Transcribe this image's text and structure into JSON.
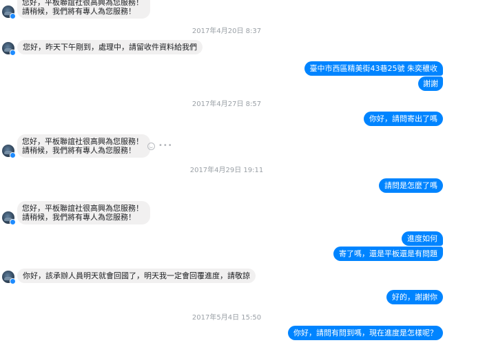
{
  "conversation": {
    "messages": [
      {
        "lines": [
          "您好，平板聯誼社很高興為您服務！",
          "請稍候，我們將有專人為您服務！"
        ]
      },
      {
        "lines": [
          "您好，昨天下午剛到，處理中，請留收件資料給我們"
        ]
      },
      {
        "lines": [
          "臺中市西區精美街43巷25號 朱奕穠收"
        ]
      },
      {
        "lines": [
          "謝謝"
        ]
      },
      {
        "lines": [
          "你好，請問寄出了嗎"
        ]
      },
      {
        "lines": [
          "您好，平板聯誼社很高興為您服務！",
          "請稍候，我們將有專人為您服務！"
        ]
      },
      {
        "lines": [
          "請問是怎麼了嗎"
        ]
      },
      {
        "lines": [
          "您好，平板聯誼社很高興為您服務！",
          "請稍候，我們將有專人為您服務！"
        ]
      },
      {
        "lines": [
          "進度如何"
        ]
      },
      {
        "lines": [
          "寄了嗎，還是平板還是有問題"
        ]
      },
      {
        "lines": [
          "你好，該承辦人員明天就會回國了，明天我一定會回覆進度，請敬諒"
        ]
      },
      {
        "lines": [
          "好的，謝謝你"
        ]
      },
      {
        "lines": [
          "你好，請問有問到嗎，現在進度是怎樣呢？"
        ]
      }
    ],
    "timestamps": [
      "2017年4月20日 8:37",
      "2017年4月27日 8:57",
      "2017年4月29日 19:11",
      "2017年5月4日 15:50"
    ],
    "hover_actions": {
      "more_label": "•••"
    },
    "colors": {
      "outgoing_bubble": "#0084ff",
      "incoming_bubble": "#f1f0f0",
      "timestamp_text": "#9aa0a6"
    }
  }
}
